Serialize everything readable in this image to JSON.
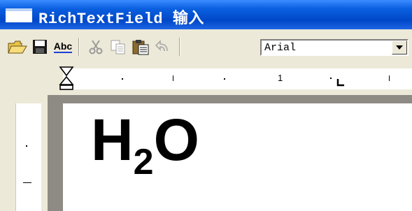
{
  "window": {
    "title": "RichTextField 输入"
  },
  "toolbar": {
    "icons": [
      "open-folder-icon",
      "save-icon",
      "spell-check-icon",
      "cut-icon",
      "copy-icon",
      "paste-icon",
      "undo-icon"
    ],
    "spell_label": "Abc",
    "font_select": {
      "value": "Arial"
    }
  },
  "ruler": {
    "label_1": "1"
  },
  "document": {
    "text_main": "H",
    "text_sub": "2",
    "text_end": "O"
  }
}
